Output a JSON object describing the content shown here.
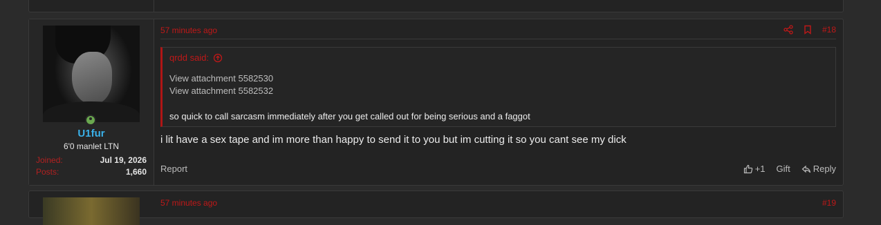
{
  "post": {
    "time": "57 minutes ago",
    "number": "#18",
    "user": {
      "name": "U1fur",
      "title": "6'0 manlet LTN",
      "joined_label": "Joined:",
      "joined_value": "Jul 19, 2026",
      "posts_label": "Posts:",
      "posts_value": "1,660"
    },
    "quote": {
      "author": "qrdd said:",
      "attachments": [
        "View attachment 5582530",
        "View attachment 5582532"
      ],
      "text": "so quick to call sarcasm immediately after you get called out for being serious and a faggot"
    },
    "message": "i lit have a sex tape and im more than happy to send it to you but im cutting it so you cant see my dick",
    "footer": {
      "report": "Report",
      "like_count": "+1",
      "gift": "Gift",
      "reply": "Reply"
    }
  },
  "next_post": {
    "time": "57 minutes ago",
    "number": "#19"
  },
  "colors": {
    "accent": "#c01818",
    "username": "#3ab0e8",
    "online": "#6aa84f",
    "background": "#2b2b2b"
  }
}
